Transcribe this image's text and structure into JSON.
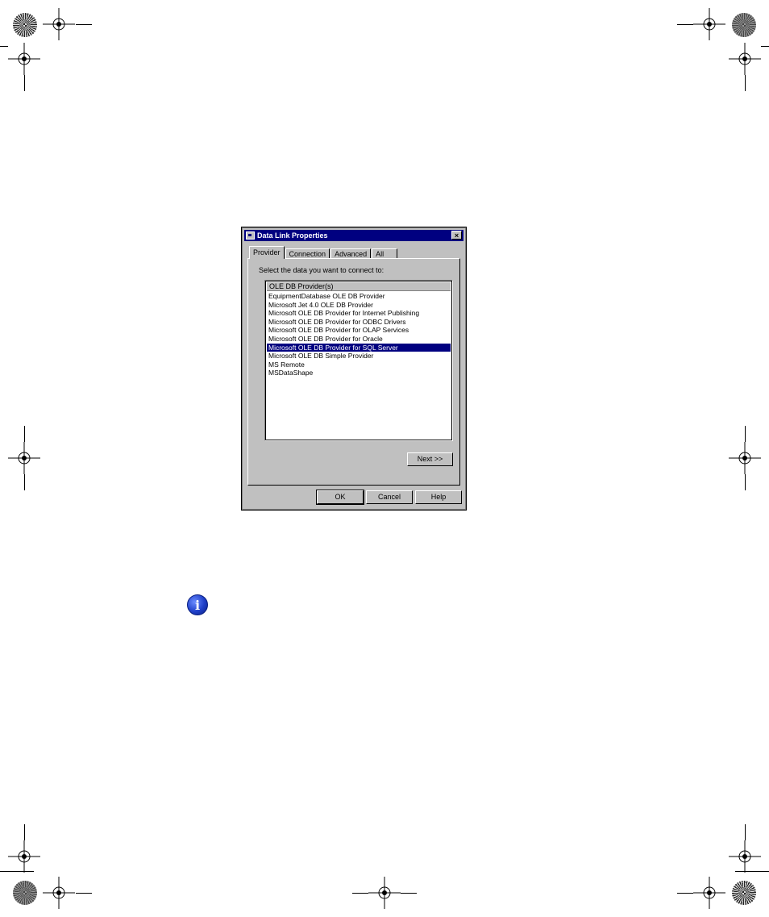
{
  "dialog": {
    "title": "Data Link Properties",
    "close_label": "×",
    "tabs": [
      {
        "label": "Provider",
        "active": true
      },
      {
        "label": "Connection",
        "active": false
      },
      {
        "label": "Advanced",
        "active": false
      },
      {
        "label": "All",
        "active": false
      }
    ],
    "instruction": "Select the data you want to connect to:",
    "list": {
      "header": "OLE DB Provider(s)",
      "items": [
        "EquipmentDatabase OLE DB Provider",
        "Microsoft Jet 4.0 OLE DB Provider",
        "Microsoft OLE DB Provider for Internet Publishing",
        "Microsoft OLE DB Provider for ODBC Drivers",
        "Microsoft OLE DB Provider for OLAP Services",
        "Microsoft OLE DB Provider for Oracle",
        "Microsoft OLE DB Provider for SQL Server",
        "Microsoft OLE DB Simple Provider",
        "MS Remote",
        "MSDataShape"
      ],
      "selected_index": 6
    },
    "buttons": {
      "next": "Next >>",
      "ok": "OK",
      "cancel": "Cancel",
      "help": "Help"
    }
  },
  "colors": {
    "titlebar": "#000080",
    "selection": "#000080",
    "face": "#c0c0c0"
  },
  "icons": {
    "info": "i"
  }
}
